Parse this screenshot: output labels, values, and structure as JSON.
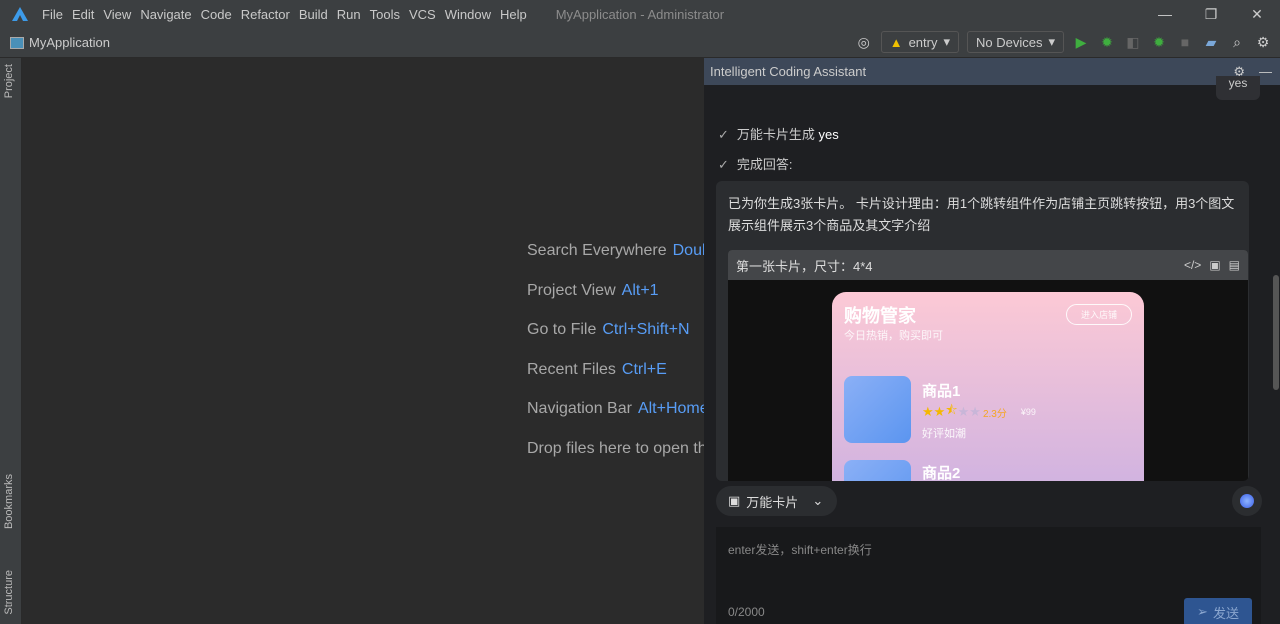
{
  "menu": [
    "File",
    "Edit",
    "View",
    "Navigate",
    "Code",
    "Refactor",
    "Build",
    "Run",
    "Tools",
    "VCS",
    "Window",
    "Help"
  ],
  "window_title": "MyApplication - Administrator",
  "project_name": "MyApplication",
  "toolbar": {
    "module": "entry",
    "device": "No Devices"
  },
  "side_tabs": {
    "project": "Project",
    "bookmarks": "Bookmarks",
    "structure": "Structure"
  },
  "hints": [
    {
      "label": "Search Everywhere",
      "key": "Double Shift"
    },
    {
      "label": "Project View",
      "key": "Alt+1"
    },
    {
      "label": "Go to File",
      "key": "Ctrl+Shift+N"
    },
    {
      "label": "Recent Files",
      "key": "Ctrl+E"
    },
    {
      "label": "Navigation Bar",
      "key": "Alt+Home"
    },
    {
      "label": "Drop files here to open them",
      "key": ""
    }
  ],
  "panel": {
    "title": "Intelligent Coding Assistant",
    "user_bubble": "yes",
    "steps": [
      {
        "label": "万能卡片生成",
        "value": "yes"
      },
      {
        "label": "完成回答:",
        "value": ""
      }
    ],
    "answer": "已为你生成3张卡片。 卡片设计理由：用1个跳转组件作为店铺主页跳转按钮，用3个图文展示组件展示3个商品及其文字介绍",
    "card_title": "第一张卡片，尺寸：4*4",
    "card": {
      "title": "购物管家",
      "subtitle": "今日热销，购买即可",
      "button": "进入店铺",
      "items": [
        {
          "name": "商品1",
          "rating": 2.3,
          "score": "2.3分",
          "price": "¥99",
          "desc": "好评如潮"
        },
        {
          "name": "商品2"
        }
      ]
    },
    "mode": "万能卡片",
    "placeholder": "enter发送，shift+enter换行",
    "counter": "0/2000",
    "send": "发送"
  }
}
